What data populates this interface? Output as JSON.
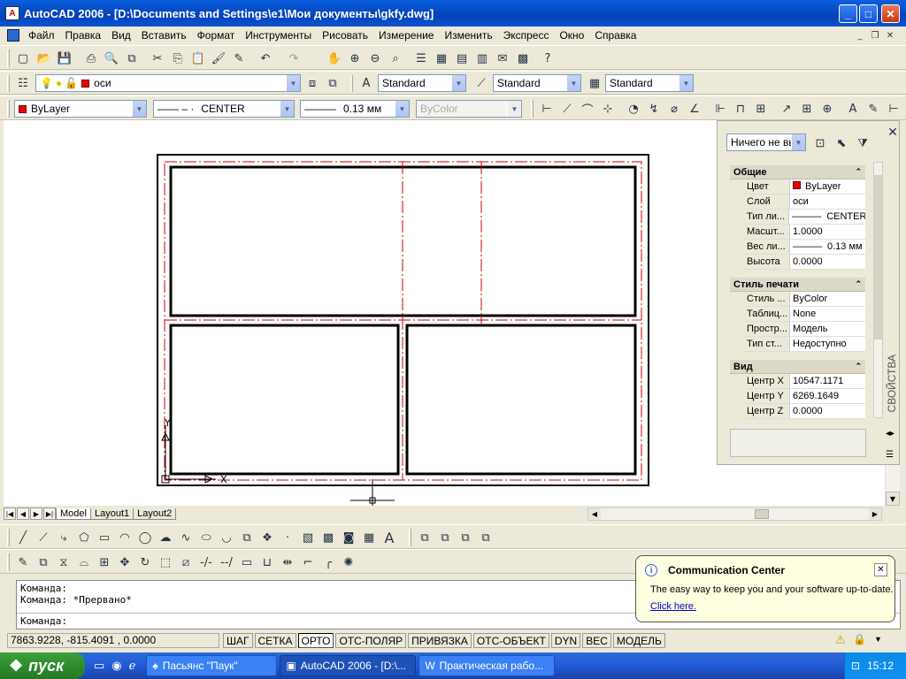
{
  "window": {
    "title": "AutoCAD 2006 - [D:\\Documents and Settings\\e1\\Мои документы\\gkfy.dwg]",
    "app_icon": "autocad-icon"
  },
  "menu": {
    "items": [
      "Файл",
      "Правка",
      "Вид",
      "Вставить",
      "Формат",
      "Инструменты",
      "Рисовать",
      "Измерение",
      "Изменить",
      "Экспресс",
      "Окно",
      "Справка"
    ]
  },
  "toolbars": {
    "layer_value": "оси",
    "textstyle": "Standard",
    "dimstyle": "Standard",
    "tablestyle": "Standard",
    "color": "ByLayer",
    "linetype": "CENTER",
    "lineweight": "0.13 мм",
    "plotstyle": "ByColor"
  },
  "palette": {
    "select_label": "Ничего не вы",
    "vertical_title": "СВОЙСТВА",
    "sections": [
      {
        "title": "Общие",
        "rows": [
          {
            "k": "Цвет",
            "v": "ByLayer"
          },
          {
            "k": "Слой",
            "v": "оси"
          },
          {
            "k": "Тип ли...",
            "v": "CENTER"
          },
          {
            "k": "Масшт...",
            "v": "1.0000"
          },
          {
            "k": "Вес ли...",
            "v": "0.13 мм"
          },
          {
            "k": "Высота",
            "v": "0.0000"
          }
        ]
      },
      {
        "title": "Стиль печати",
        "rows": [
          {
            "k": "Стиль ...",
            "v": "ByColor"
          },
          {
            "k": "Таблиц...",
            "v": "None"
          },
          {
            "k": "Простр...",
            "v": "Модель"
          },
          {
            "k": "Тип ст...",
            "v": "Недоступно"
          }
        ]
      },
      {
        "title": "Вид",
        "rows": [
          {
            "k": "Центр X",
            "v": "10547.1171"
          },
          {
            "k": "Центр Y",
            "v": "6269.1649"
          },
          {
            "k": "Центр Z",
            "v": "0.0000"
          }
        ]
      }
    ]
  },
  "layout_tabs": [
    "Model",
    "Layout1",
    "Layout2"
  ],
  "ucs": {
    "x_label": "X",
    "y_label": "Y"
  },
  "command": {
    "lines": [
      "Команда:",
      "Команда: *Прервано*"
    ],
    "prompt": "Команда:"
  },
  "status": {
    "coords": "7863.9228, -815.4091 , 0.0000",
    "buttons": [
      {
        "label": "ШАГ",
        "on": false
      },
      {
        "label": "СЕТКА",
        "on": false
      },
      {
        "label": "ОРТО",
        "on": true
      },
      {
        "label": "ОТС-ПОЛЯР",
        "on": false
      },
      {
        "label": "ПРИВЯЗКА",
        "on": false
      },
      {
        "label": "ОТС-ОБЪЕКТ",
        "on": false
      },
      {
        "label": "DYN",
        "on": false
      },
      {
        "label": "ВЕС",
        "on": false
      },
      {
        "label": "МОДЕЛЬ",
        "on": false
      }
    ]
  },
  "balloon": {
    "title": "Communication Center",
    "text": "The easy way to keep you and your software up-to-date.",
    "link": "Click here."
  },
  "taskbar": {
    "start": "пуск",
    "tasks": [
      {
        "label": "Пасьянс \"Паук\"",
        "active": false
      },
      {
        "label": "AutoCAD 2006 - [D:\\...",
        "active": true
      },
      {
        "label": "Практическая рабо...",
        "active": false
      }
    ],
    "clock": "15:12"
  },
  "colors": {
    "accent": "#0a5fdc",
    "red_axis": "#cc0000",
    "swatch": "#e00000"
  }
}
